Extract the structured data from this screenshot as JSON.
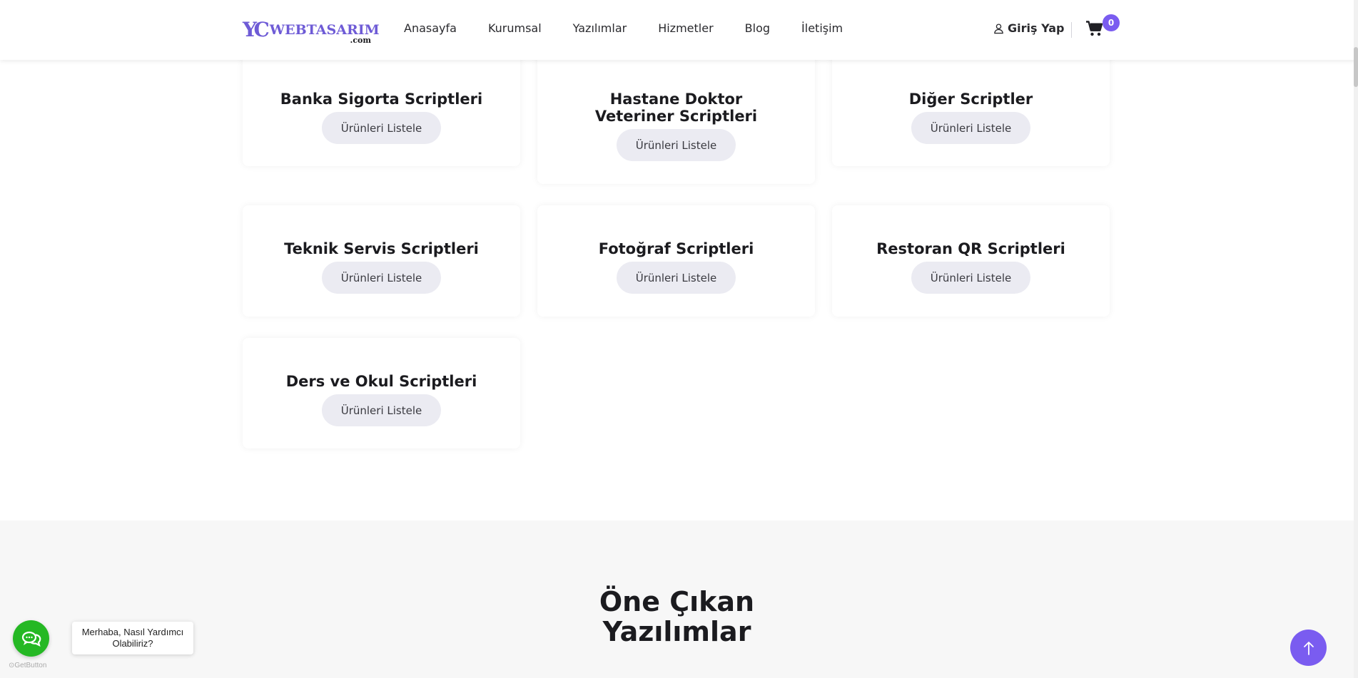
{
  "brand": {
    "mark": "YC",
    "word": "WEBTASARIM",
    "suffix": ".com",
    "color": "#6e5bd6"
  },
  "nav": {
    "items": [
      "Anasayfa",
      "Kurumsal",
      "Yazılımlar",
      "Hizmetler",
      "Blog",
      "İletişim"
    ]
  },
  "header": {
    "login_label": "Giriş Yap",
    "cart_count": "0",
    "accent_color": "#7a5cf0"
  },
  "categories": [
    {
      "title": "Banka Sigorta Scriptleri",
      "button": "Ürünleri Listele"
    },
    {
      "title": "Hastane Doktor Veteriner Scriptleri",
      "button": "Ürünleri Listele"
    },
    {
      "title": "Diğer Scriptler",
      "button": "Ürünleri Listele"
    },
    {
      "title": "Teknik Servis Scriptleri",
      "button": "Ürünleri Listele"
    },
    {
      "title": "Fotoğraf Scriptleri",
      "button": "Ürünleri Listele"
    },
    {
      "title": "Restoran QR Scriptleri",
      "button": "Ürünleri Listele"
    },
    {
      "title": "Ders ve Okul Scriptleri",
      "button": "Ürünleri Listele"
    }
  ],
  "featured": {
    "title_line1": "Öne Çıkan",
    "title_line2": "Yazılımlar"
  },
  "chat_widget": {
    "message": "Merhaba, Nasıl Yardımcı Olabiliriz?",
    "powered_by": "GetButton",
    "button_color": "#25b824"
  },
  "icons": {
    "user": "user-icon",
    "cart": "cart-icon",
    "chat": "chat-icon",
    "scroll_top": "arrow-up-icon"
  }
}
